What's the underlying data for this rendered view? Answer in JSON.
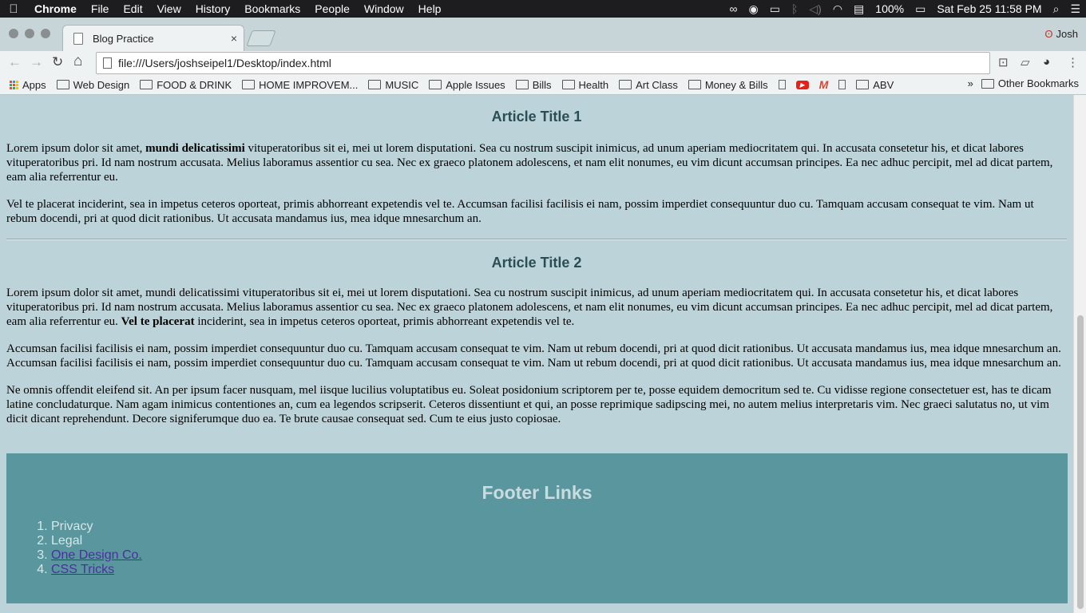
{
  "menubar": {
    "apple": "",
    "app": "Chrome",
    "items": [
      "File",
      "Edit",
      "View",
      "History",
      "Bookmarks",
      "People",
      "Window",
      "Help"
    ],
    "battery": "100%",
    "datetime": "Sat Feb 25  11:58 PM",
    "icons": [
      "glasses-icon",
      "creative-cloud-icon",
      "airplay-icon",
      "bluetooth-icon",
      "volume-icon",
      "wifi-icon",
      "us-flag-icon",
      "battery-icon",
      "spotlight-search-icon",
      "notification-center-icon"
    ]
  },
  "tabs": [
    {
      "title": "Blog Practice",
      "close": "×"
    }
  ],
  "profile": {
    "name": "Josh"
  },
  "toolbar": {
    "url": "file:///Users/joshseipel1/Desktop/index.html",
    "back": "←",
    "forward": "→",
    "reload": "↻",
    "home": "⌂"
  },
  "bookmarks": {
    "apps": "Apps",
    "items": [
      "Web Design",
      "FOOD & DRINK",
      "HOME IMPROVEM...",
      "MUSIC",
      "Apple Issues",
      "Bills",
      "Health",
      "Art Class",
      "Money & Bills"
    ],
    "abv": "ABV",
    "overflow": "»",
    "other": "Other Bookmarks"
  },
  "articles": [
    {
      "title": "Article Title 1",
      "p1": {
        "before": "Lorem ipsum dolor sit amet, ",
        "bold": "mundi delicatissimi",
        "after": " vituperatoribus sit ei, mei ut lorem disputationi. Sea cu nostrum suscipit inimicus, ad unum aperiam mediocritatem qui. In accusata consetetur his, et dicat labores vituperatoribus pri. Id nam nostrum accusata. Melius laboramus assentior cu sea. Nec ex graeco platonem adolescens, et nam elit nonumes, eu vim dicunt accumsan principes. Ea nec adhuc percipit, mel ad dicat partem, eam alia referrentur eu."
      },
      "p2": "Vel te placerat inciderint, sea in impetus ceteros oporteat, primis abhorreant expetendis vel te. Accumsan facilisi facilisis ei nam, possim imperdiet consequuntur duo cu. Tamquam accusam consequat te vim. Nam ut rebum docendi, pri at quod dicit rationibus. Ut accusata mandamus ius, mea idque mnesarchum an."
    },
    {
      "title": "Article Title 2",
      "p1": {
        "before": "Lorem ipsum dolor sit amet, mundi delicatissimi vituperatoribus sit ei, mei ut lorem disputationi. Sea cu nostrum suscipit inimicus, ad unum aperiam mediocritatem qui. In accusata consetetur his, et dicat labores vituperatoribus pri. Id nam nostrum accusata. Melius laboramus assentior cu sea. Nec ex graeco platonem adolescens, et nam elit nonumes, eu vim dicunt accumsan principes. Ea nec adhuc percipit, mel ad dicat partem, eam alia referrentur eu. ",
        "bold": "Vel te placerat",
        "after": " inciderint, sea in impetus ceteros oporteat, primis abhorreant expetendis vel te."
      },
      "p2": "Accumsan facilisi facilisis ei nam, possim imperdiet consequuntur duo cu. Tamquam accusam consequat te vim. Nam ut rebum docendi, pri at quod dicit rationibus. Ut accusata mandamus ius, mea idque mnesarchum an. Accumsan facilisi facilisis ei nam, possim imperdiet consequuntur duo cu. Tamquam accusam consequat te vim. Nam ut rebum docendi, pri at quod dicit rationibus. Ut accusata mandamus ius, mea idque mnesarchum an.",
      "p3": "Ne omnis offendit eleifend sit. An per ipsum facer nusquam, mel iisque lucilius voluptatibus eu. Soleat posidonium scriptorem per te, posse equidem democritum sed te. Cu vidisse regione consectetuer est, has te dicam latine concludaturque. Nam agam inimicus contentiones an, cum ea legendos scripserit. Ceteros dissentiunt et qui, an posse reprimique sadipscing mei, no autem melius interpretaris vim. Nec graeci salutatus no, ut vim dicit dicant reprehendunt. Decore signiferumque duo ea. Te brute causae consequat sed. Cum te eius justo copiosae."
    }
  ],
  "footer": {
    "title": "Footer Links",
    "links": [
      "Privacy",
      "Legal",
      "One Design Co.",
      "CSS Tricks"
    ]
  },
  "colors": {
    "page_bg": "#bcd4d9",
    "footer_bg": "#5a969e",
    "title": "#2b4e54",
    "link": "#4b2fa0"
  }
}
